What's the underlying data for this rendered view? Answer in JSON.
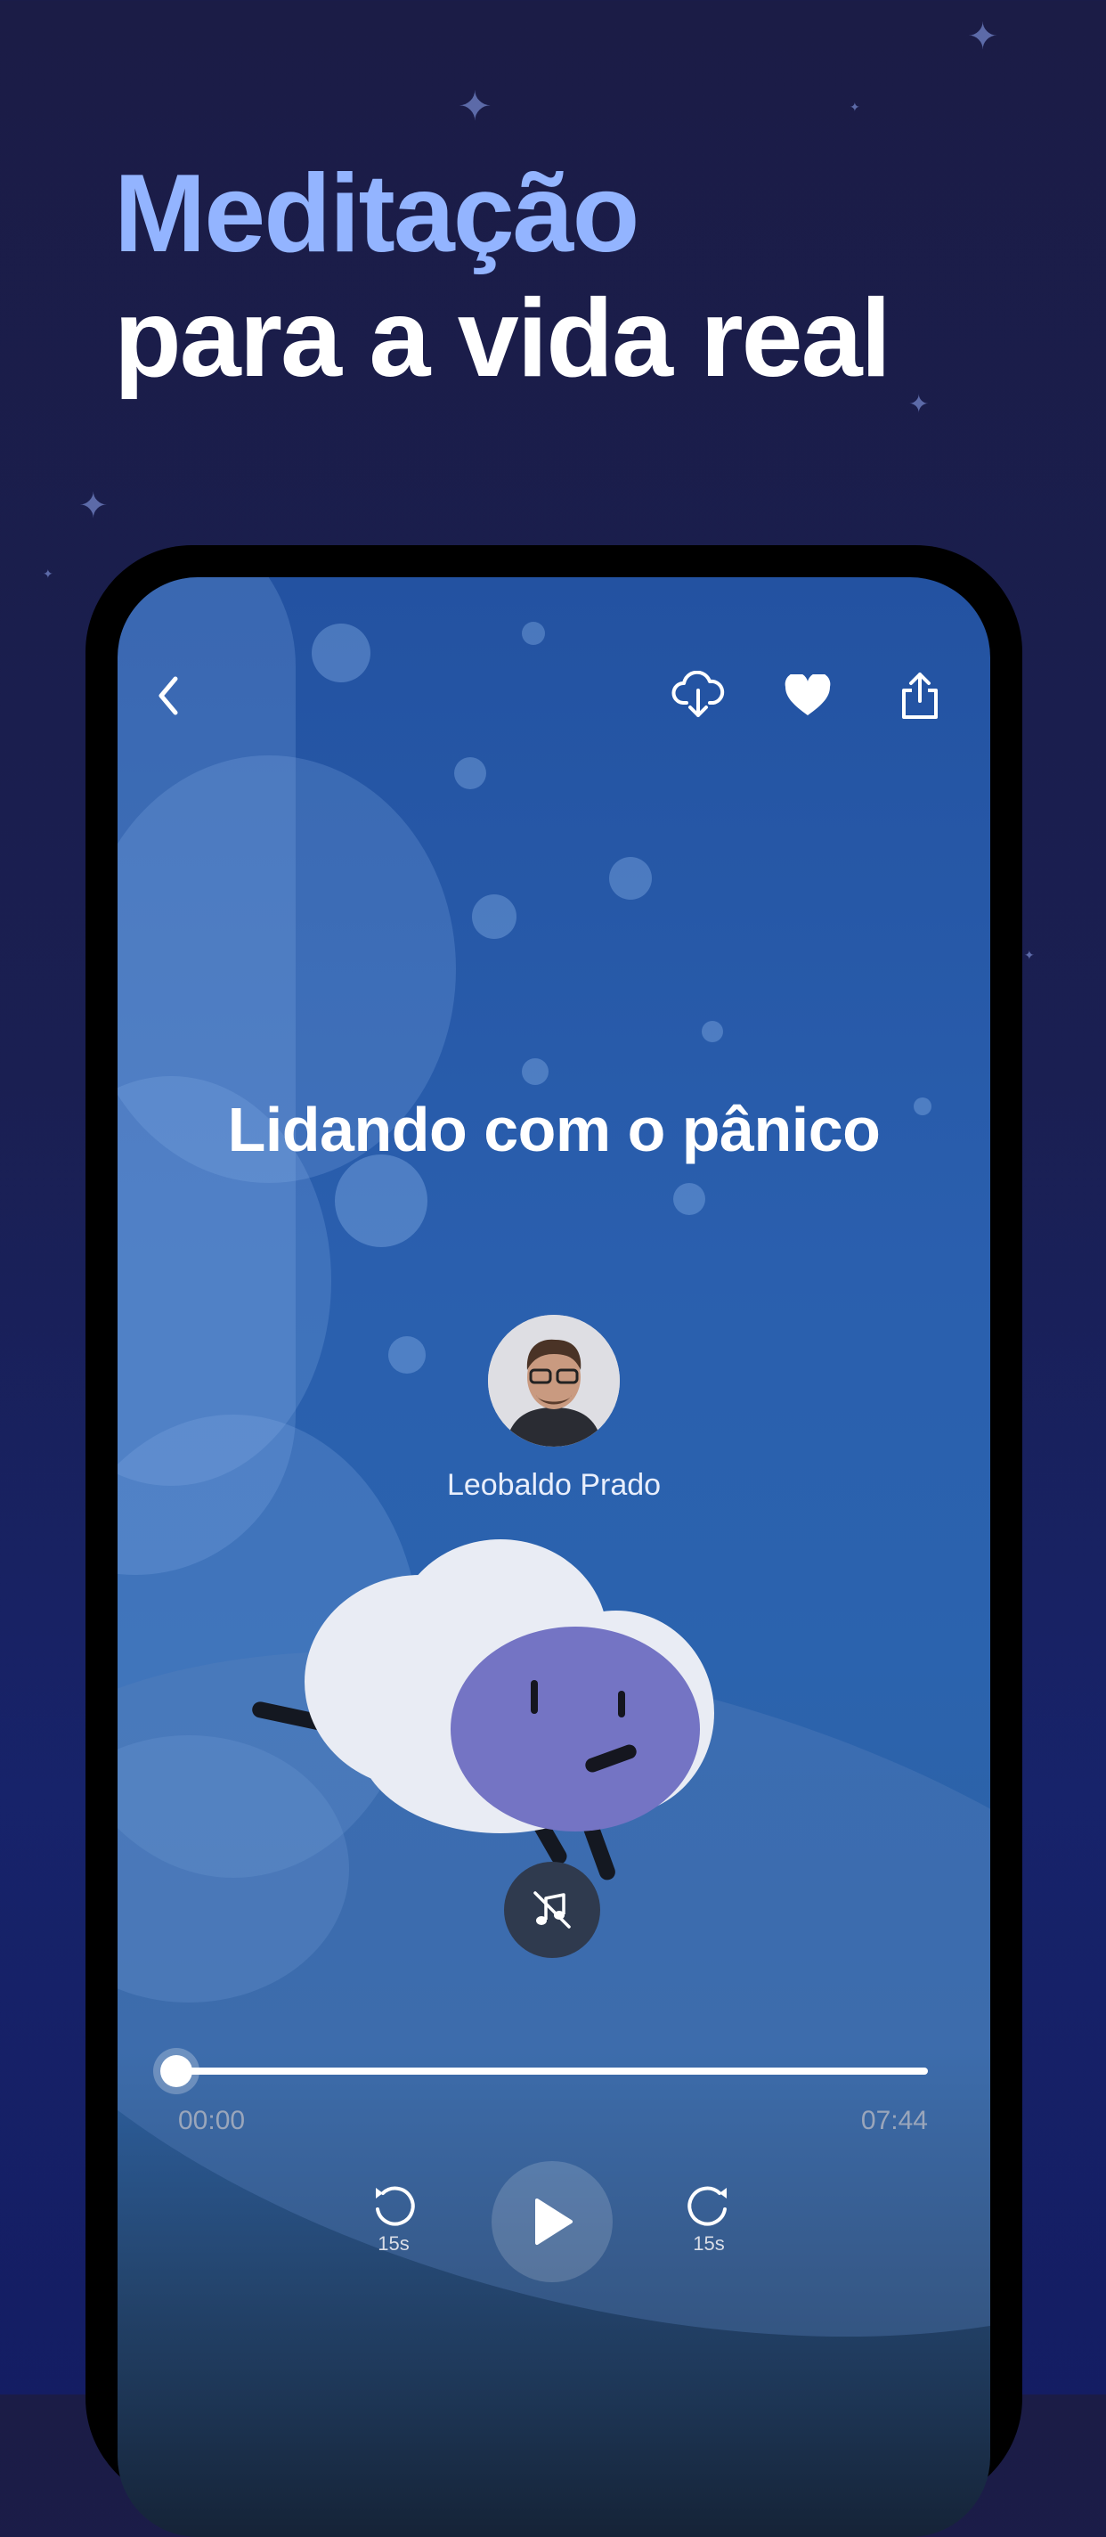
{
  "headline": {
    "line1": "Meditação",
    "line2": "para a vida real"
  },
  "player": {
    "title": "Lidando com o pânico",
    "author": "Leobaldo Prado",
    "time_elapsed": "00:00",
    "time_total": "07:44",
    "progress": 0,
    "rewind_label": "15s",
    "forward_label": "15s"
  },
  "colors": {
    "accent": "#93b4ff",
    "background": "#1b1c46",
    "screen_blue": "#2a5fae"
  },
  "icons": {
    "back": "chevron-left-icon",
    "download": "cloud-download-icon",
    "favorite": "heart-icon",
    "share": "share-icon",
    "mute_music": "music-off-icon",
    "rewind": "rewind-15-icon",
    "play": "play-icon",
    "forward": "forward-15-icon"
  }
}
